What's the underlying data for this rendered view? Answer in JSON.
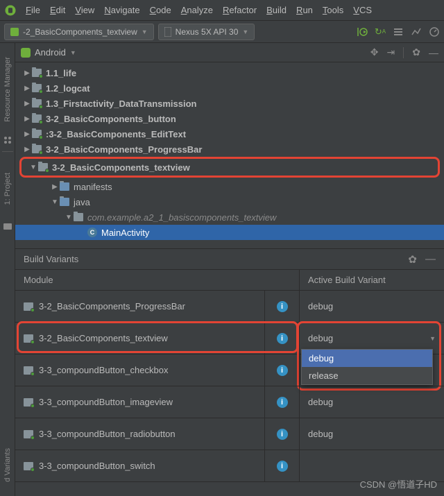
{
  "menu": {
    "items": [
      "File",
      "Edit",
      "View",
      "Navigate",
      "Code",
      "Analyze",
      "Refactor",
      "Build",
      "Run",
      "Tools",
      "VCS"
    ]
  },
  "toolbar": {
    "config_selector": "-2_BasicComponents_textview",
    "device_selector": "Nexus 5X API 30"
  },
  "left_rails": {
    "rail1": "Resource Manager",
    "rail2": "1: Project",
    "rail3": "d Variants"
  },
  "project_header": {
    "title": "Android"
  },
  "tree": {
    "items": [
      {
        "indent": 0,
        "arrow": "▶",
        "label": "1.1_life",
        "bold": true
      },
      {
        "indent": 0,
        "arrow": "▶",
        "label": "1.2_logcat",
        "bold": true
      },
      {
        "indent": 0,
        "arrow": "▶",
        "label": "1.3_Firstactivity_DataTransmission",
        "bold": true
      },
      {
        "indent": 0,
        "arrow": "▶",
        "label": "3-2_BasicComponents_button",
        "bold": true
      },
      {
        "indent": 0,
        "arrow": "▶",
        "label": ":3-2_BasicComponents_EditText",
        "bold": true
      },
      {
        "indent": 0,
        "arrow": "▶",
        "label": "3-2_BasicComponents_ProgressBar",
        "bold": true
      }
    ],
    "highlighted": {
      "indent": 0,
      "arrow": "▼",
      "label": "3-2_BasicComponents_textview",
      "bold": true
    },
    "children": [
      {
        "indent": 1,
        "arrow": "▶",
        "label": "manifests",
        "open": true
      },
      {
        "indent": 1,
        "arrow": "▼",
        "label": "java",
        "open": true
      },
      {
        "indent": 2,
        "arrow": "▼",
        "label": "com.example.a2_1_basiscomponents_textview",
        "pkg": true
      },
      {
        "indent": 3,
        "arrow": "",
        "label": "MainActivity",
        "class": true,
        "sel": true
      }
    ]
  },
  "build_variants": {
    "title": "Build Variants",
    "col1": "Module",
    "col2": "Active Build Variant",
    "rows": [
      {
        "module": "3-2_BasicComponents_ProgressBar",
        "variant": "debug"
      },
      {
        "module": "3-2_BasicComponents_textview",
        "variant": "debug",
        "dropdown": true,
        "highlighted": true
      },
      {
        "module": "3-3_compoundButton_checkbox",
        "variant": "debug"
      },
      {
        "module": "3-3_compoundButton_imageview",
        "variant": "debug"
      },
      {
        "module": "3-3_compoundButton_radiobutton",
        "variant": "debug"
      },
      {
        "module": "3-3_compoundButton_switch",
        "variant": ""
      }
    ],
    "dropdown_options": [
      "debug",
      "release"
    ]
  },
  "watermark": "CSDN @悟道子HD"
}
